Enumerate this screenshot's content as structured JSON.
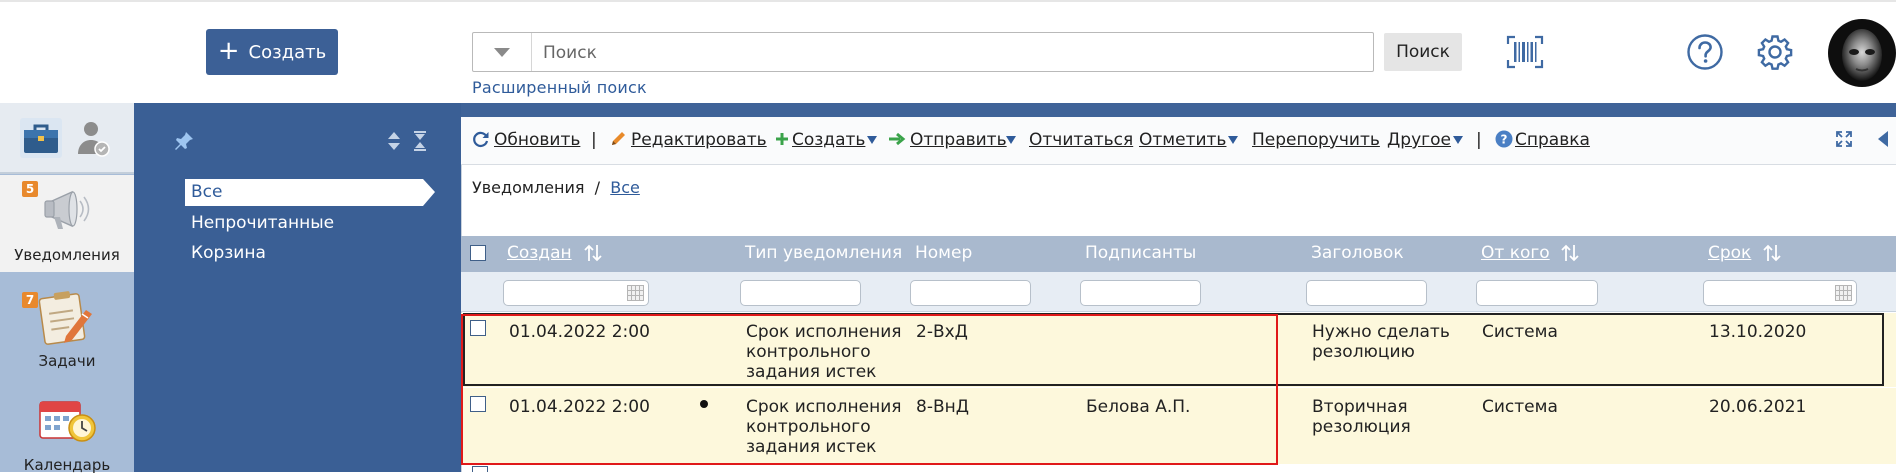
{
  "header": {
    "create_label": "Создать",
    "search_placeholder": "Поиск",
    "search_button": "Поиск",
    "advanced_search": "Расширенный поиск"
  },
  "nav": {
    "items": [
      {
        "label": "Уведомления",
        "badge": "5"
      },
      {
        "label": "Задачи",
        "badge": "7"
      },
      {
        "label": "Календарь",
        "badge": ""
      }
    ]
  },
  "folders": [
    "Все",
    "Непрочитанные",
    "Корзина"
  ],
  "toolbar": {
    "refresh": "Обновить",
    "edit": "Редактировать",
    "create": "Создать",
    "send": "Отправить",
    "report": "Отчитаться",
    "mark": "Отметить",
    "reassign": "Перепоручить",
    "other": "Другое",
    "help": "Справка",
    "separator": "|"
  },
  "breadcrumb": {
    "root": "Уведомления",
    "separator": "/",
    "current": "Все"
  },
  "table": {
    "columns": [
      "Создан",
      "Тип уведомления",
      "Номер",
      "Подписанты",
      "Заголовок",
      "От кого",
      "Срок"
    ],
    "rows": [
      {
        "created": "01.04.2022 2:00",
        "type": [
          "Срок исполнения",
          "контрольного",
          "задания истек"
        ],
        "number": "2-ВхД",
        "signers": "",
        "title": [
          "Нужно сделать",
          "резолюцию"
        ],
        "from": "Система",
        "due": "13.10.2020",
        "unread": false
      },
      {
        "created": "01.04.2022 2:00",
        "type": [
          "Срок исполнения",
          "контрольного",
          "задания истек"
        ],
        "number": "8-ВнД",
        "signers": "Белова А.П.",
        "title": [
          "Вторичная",
          "резолюция"
        ],
        "from": "Система",
        "due": "20.06.2021",
        "unread": true
      }
    ]
  },
  "colors": {
    "accent": "#3c6096",
    "panel": "#3a5f95",
    "rail": "#a7bcd7",
    "table_header": "#a9b9ce",
    "row_highlight": "#fdf8dc",
    "selection_outline": "#e01919",
    "link": "#2f5b9a"
  }
}
